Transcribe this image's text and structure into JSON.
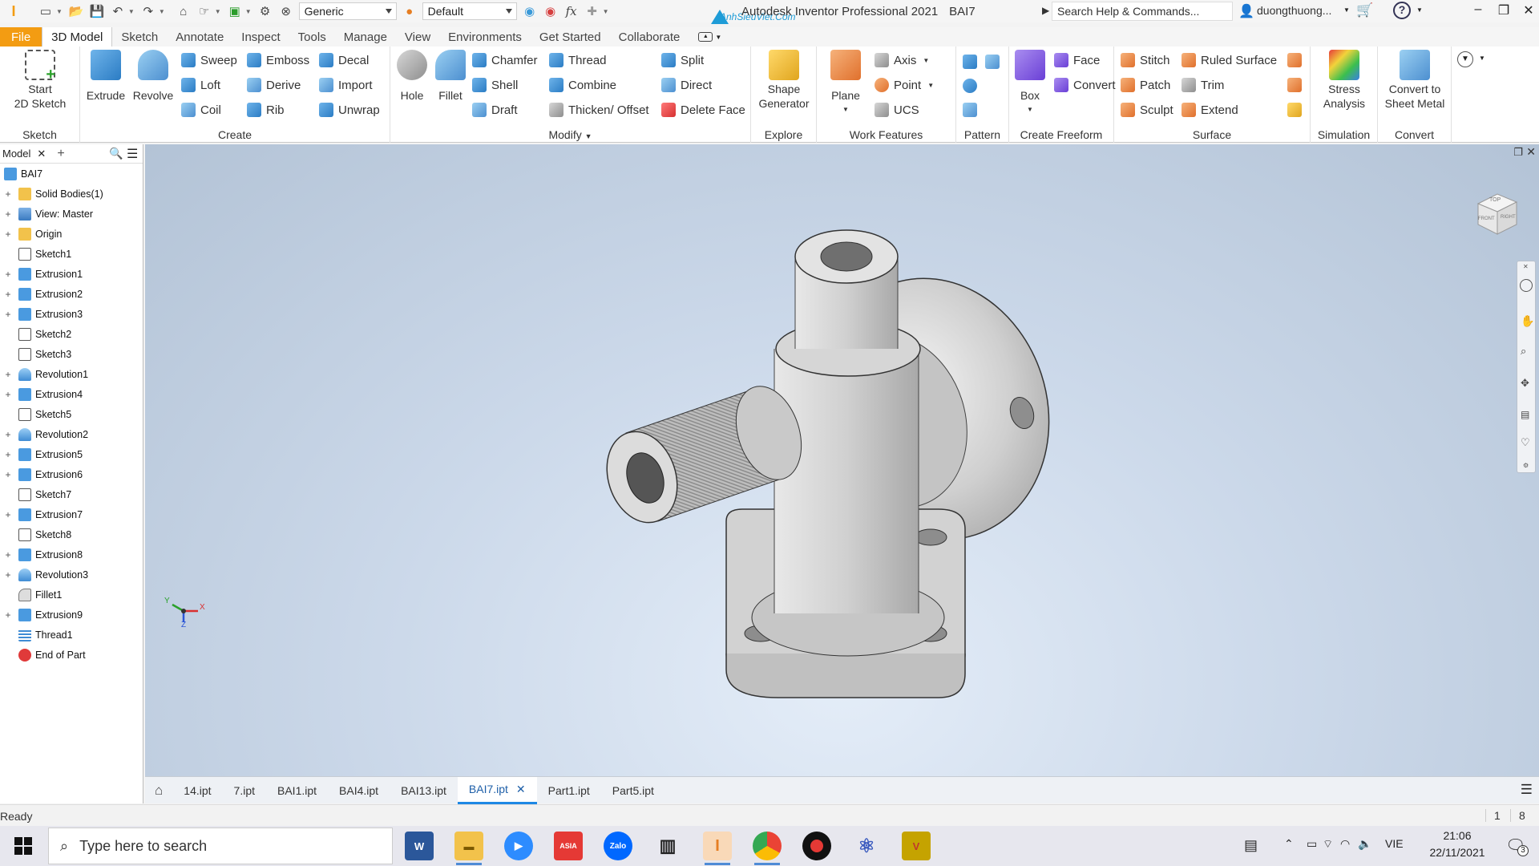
{
  "titlebar": {
    "material": "Generic",
    "appearance": "Default",
    "app_title": "Autodesk Inventor Professional 2021",
    "doc_name": "BAI7",
    "watermark": "AnhSieuViet.Com",
    "search_placeholder": "Search Help & Commands...",
    "user": "duongthuong..."
  },
  "menu": [
    "File",
    "3D Model",
    "Sketch",
    "Annotate",
    "Inspect",
    "Tools",
    "Manage",
    "View",
    "Environments",
    "Get Started",
    "Collaborate"
  ],
  "ribbon": {
    "sketch": {
      "start_label_1": "Start",
      "start_label_2": "2D Sketch",
      "panel": "Sketch"
    },
    "create": {
      "extrude": "Extrude",
      "revolve": "Revolve",
      "sweep": "Sweep",
      "loft": "Loft",
      "coil": "Coil",
      "emboss": "Emboss",
      "derive": "Derive",
      "rib": "Rib",
      "decal": "Decal",
      "import": "Import",
      "unwrap": "Unwrap",
      "panel": "Create"
    },
    "modify": {
      "hole": "Hole",
      "fillet": "Fillet",
      "chamfer": "Chamfer",
      "shell": "Shell",
      "draft": "Draft",
      "thread": "Thread",
      "combine": "Combine",
      "thicken": "Thicken/ Offset",
      "split": "Split",
      "direct": "Direct",
      "delete_face": "Delete Face",
      "panel": "Modify"
    },
    "explore": {
      "shape_1": "Shape",
      "shape_2": "Generator",
      "panel": "Explore"
    },
    "work": {
      "plane": "Plane",
      "axis": "Axis",
      "point": "Point",
      "ucs": "UCS",
      "panel": "Work Features"
    },
    "pattern": {
      "panel": "Pattern"
    },
    "freeform": {
      "box": "Box",
      "face": "Face",
      "convert": "Convert",
      "panel": "Create Freeform"
    },
    "surface": {
      "stitch": "Stitch",
      "patch": "Patch",
      "sculpt": "Sculpt",
      "ruled": "Ruled Surface",
      "trim": "Trim",
      "extend": "Extend",
      "panel": "Surface"
    },
    "simulation": {
      "stress_1": "Stress",
      "stress_2": "Analysis",
      "panel": "Simulation"
    },
    "convert": {
      "sm_1": "Convert to",
      "sm_2": "Sheet Metal",
      "panel": "Convert"
    }
  },
  "browser": {
    "tab": "Model",
    "items": [
      {
        "label": "BAI7",
        "icon": "part",
        "expand": ""
      },
      {
        "label": "Solid Bodies(1)",
        "icon": "folder",
        "expand": "+"
      },
      {
        "label": "View: Master",
        "icon": "view",
        "expand": "+"
      },
      {
        "label": "Origin",
        "icon": "folder",
        "expand": "+"
      },
      {
        "label": "Sketch1",
        "icon": "sketch",
        "expand": ""
      },
      {
        "label": "Extrusion1",
        "icon": "body",
        "expand": "+"
      },
      {
        "label": "Extrusion2",
        "icon": "body",
        "expand": "+"
      },
      {
        "label": "Extrusion3",
        "icon": "body",
        "expand": "+"
      },
      {
        "label": "Sketch2",
        "icon": "sketch",
        "expand": ""
      },
      {
        "label": "Sketch3",
        "icon": "sketch",
        "expand": ""
      },
      {
        "label": "Revolution1",
        "icon": "rev",
        "expand": "+"
      },
      {
        "label": "Extrusion4",
        "icon": "body",
        "expand": "+"
      },
      {
        "label": "Sketch5",
        "icon": "sketch",
        "expand": ""
      },
      {
        "label": "Revolution2",
        "icon": "rev",
        "expand": "+"
      },
      {
        "label": "Extrusion5",
        "icon": "body",
        "expand": "+"
      },
      {
        "label": "Extrusion6",
        "icon": "body",
        "expand": "+"
      },
      {
        "label": "Sketch7",
        "icon": "sketch",
        "expand": ""
      },
      {
        "label": "Extrusion7",
        "icon": "body",
        "expand": "+"
      },
      {
        "label": "Sketch8",
        "icon": "sketch",
        "expand": ""
      },
      {
        "label": "Extrusion8",
        "icon": "body",
        "expand": "+"
      },
      {
        "label": "Revolution3",
        "icon": "rev",
        "expand": "+"
      },
      {
        "label": "Fillet1",
        "icon": "fillet",
        "expand": ""
      },
      {
        "label": "Extrusion9",
        "icon": "body",
        "expand": "+"
      },
      {
        "label": "Thread1",
        "icon": "thread",
        "expand": ""
      },
      {
        "label": "End of Part",
        "icon": "end",
        "expand": ""
      }
    ]
  },
  "viewcube": {
    "top": "TOP",
    "front": "FRONT",
    "right": "RIGHT"
  },
  "triad": {
    "x": "X",
    "y": "Y",
    "z": "Z"
  },
  "doc_tabs": [
    {
      "label": "14.ipt",
      "active": false
    },
    {
      "label": "7.ipt",
      "active": false
    },
    {
      "label": "BAI1.ipt",
      "active": false
    },
    {
      "label": "BAI4.ipt",
      "active": false
    },
    {
      "label": "BAI13.ipt",
      "active": false
    },
    {
      "label": "BAI7.ipt",
      "active": true
    },
    {
      "label": "Part1.ipt",
      "active": false
    },
    {
      "label": "Part5.ipt",
      "active": false
    }
  ],
  "status": {
    "text": "Ready",
    "num1": "1",
    "num2": "8"
  },
  "taskbar": {
    "search_placeholder": "Type here to search",
    "lang": "VIE",
    "time": "21:06",
    "date": "22/11/2021",
    "notif_count": "3"
  },
  "colors": {
    "file_tab": "#f39c12",
    "accent": "#1e88e5"
  }
}
